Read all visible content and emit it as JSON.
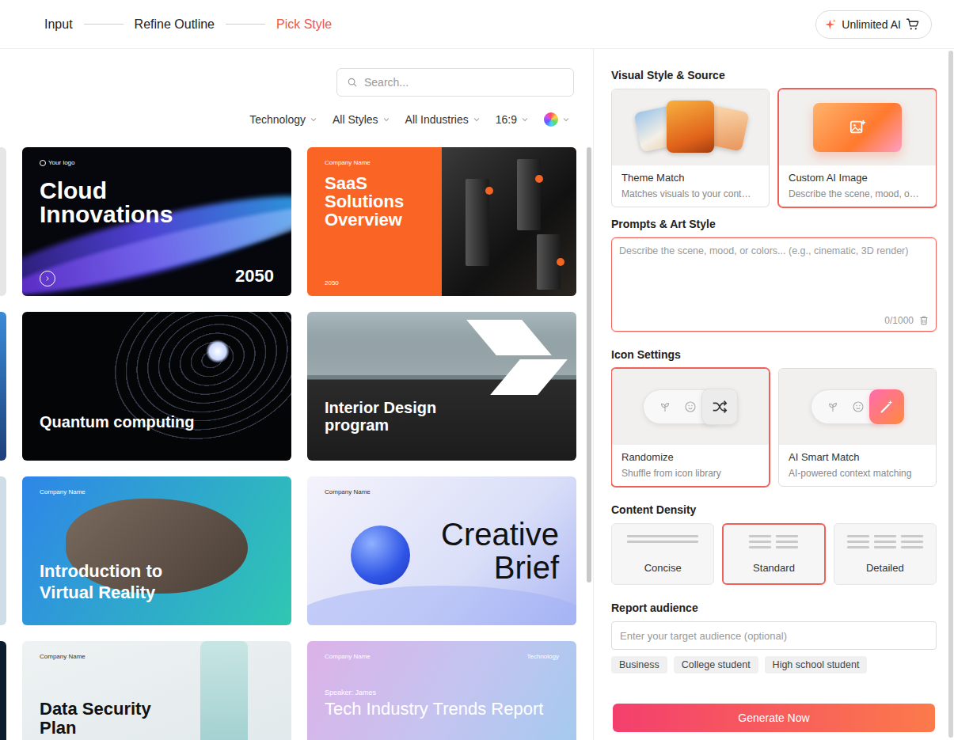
{
  "topbar": {
    "steps": [
      {
        "label": "Input",
        "selected": false
      },
      {
        "label": "Refine Outline",
        "selected": false
      },
      {
        "label": "Pick Style",
        "selected": true
      }
    ],
    "upgrade_button": "Unlimited AI"
  },
  "templates": {
    "search": {
      "placeholder": "Search..."
    },
    "filters": [
      {
        "label": "Technology"
      },
      {
        "label": "All Styles"
      },
      {
        "label": "All Industries"
      },
      {
        "label": "16:9"
      }
    ],
    "cards": [
      {
        "kind": "cloud",
        "title": "Cloud Innovations",
        "top_left": "Your logo",
        "bottom_right": "2050"
      },
      {
        "kind": "saas",
        "title": "SaaS Solutions Overview",
        "top_left": "Company Name",
        "bottom_left": "2050"
      },
      {
        "kind": "quantum",
        "title": "Quantum computing"
      },
      {
        "kind": "interior",
        "title": "Interior Design program"
      },
      {
        "kind": "vr",
        "title": "Introduction to Virtual Reality",
        "top_left": "Company Name"
      },
      {
        "kind": "creative",
        "title": "Creative Brief",
        "top_left": "Company Name"
      },
      {
        "kind": "datasec",
        "title": "Data Security Plan",
        "top_left": "Company Name"
      },
      {
        "kind": "tech",
        "title": "Tech Industry Trends Report",
        "top_left": "Company Name",
        "top_right": "Technology",
        "pre": "Speaker: James"
      }
    ]
  },
  "settings": {
    "visual_style": {
      "heading": "Visual Style & Source",
      "options": [
        {
          "kind": "photos",
          "title": "Theme Match",
          "description": "Matches visuals to your cont…",
          "selected": false
        },
        {
          "kind": "ai-image",
          "title": "Custom AI Image",
          "description": "Describe the scene, mood, o…",
          "selected": true
        }
      ]
    },
    "prompt": {
      "heading": "Prompts & Art Style",
      "placeholder": "Describe the scene, mood, or colors... (e.g., cinematic, 3D render)",
      "counter": "0/1000"
    },
    "icon_settings": {
      "heading": "Icon Settings",
      "options": [
        {
          "kind": "shuffle",
          "title": "Randomize",
          "description": "Shuffle from icon library",
          "selected": true
        },
        {
          "kind": "smart",
          "title": "AI Smart Match",
          "description": "AI-powered context matching",
          "selected": false
        }
      ]
    },
    "content_density": {
      "heading": "Content Density",
      "options": [
        {
          "kind": "concise",
          "label": "Concise",
          "selected": false
        },
        {
          "kind": "standard",
          "label": "Standard",
          "selected": true
        },
        {
          "kind": "detailed",
          "label": "Detailed",
          "selected": false
        }
      ]
    },
    "audience": {
      "heading": "Report audience",
      "placeholder": "Enter your target audience (optional)",
      "chips": [
        "Business",
        "College student",
        "High school student"
      ]
    }
  },
  "generate_button": "Generate Now"
}
